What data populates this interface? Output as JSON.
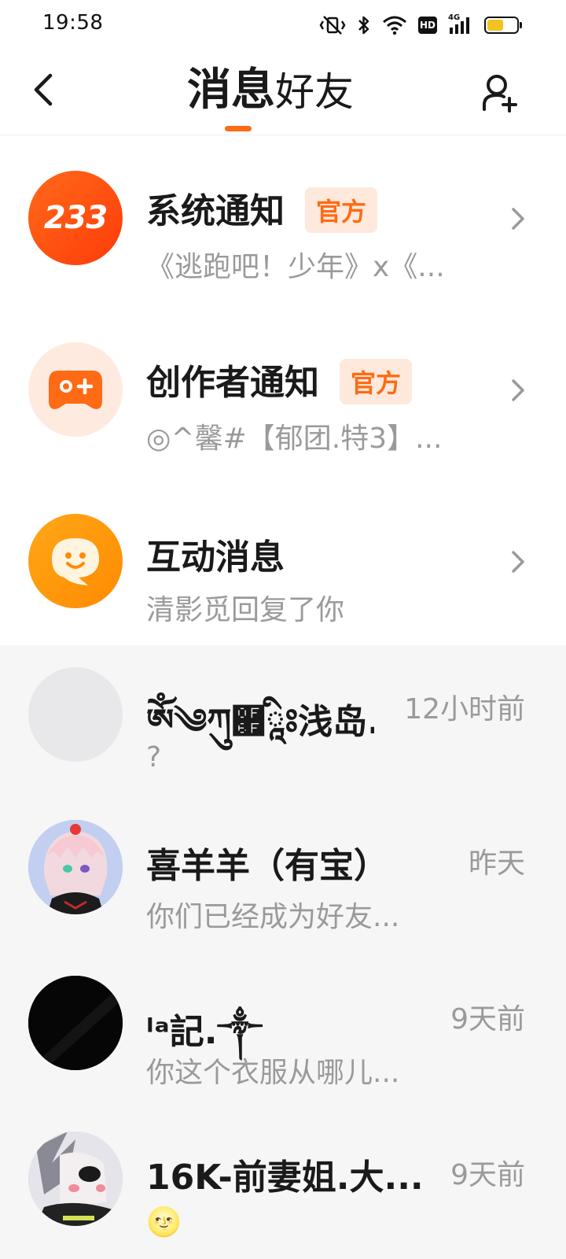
{
  "status_bar": {
    "time": "19:58",
    "hd_label": "HD",
    "network_label": "4G",
    "icons": [
      "vibrate-off-icon",
      "bluetooth-icon",
      "wifi-icon",
      "hd-icon",
      "signal-icon",
      "battery-icon"
    ],
    "battery_level": 0.55
  },
  "header": {
    "tabs": [
      {
        "label": "消息",
        "active": true
      },
      {
        "label": "好友",
        "active": false
      }
    ],
    "accent_color": "#ff6a14"
  },
  "notifications": [
    {
      "title": "系统通知",
      "badge": "官方",
      "subtitle": "《逃跑吧！少年》x《...",
      "avatar_text": "233",
      "avatar_color": "#ff4d10"
    },
    {
      "title": "创作者通知",
      "badge": "官方",
      "subtitle": "◎^馨#【郁团.特3】...",
      "avatar_icon": "gamepad-icon",
      "avatar_color": "#ffeae0"
    },
    {
      "title": "互动消息",
      "subtitle": "清影觅回复了你",
      "avatar_icon": "chat-bubble-icon",
      "avatar_color": "#ff9a0a"
    }
  ],
  "chats": [
    {
      "name": "ༀ༄ཀུ཯ཱིཿ浅岛...",
      "time": "12小时前",
      "preview": "?"
    },
    {
      "name": "喜羊羊（有宝）",
      "time": "昨天",
      "preview": "你们已经成为好友..."
    },
    {
      "name": "ˡᵃ記.༒",
      "time": "9天前",
      "preview": "你这个衣服从哪儿..."
    },
    {
      "name": "16K-前妻姐.大...",
      "time": "9天前",
      "preview": "🌝"
    }
  ]
}
